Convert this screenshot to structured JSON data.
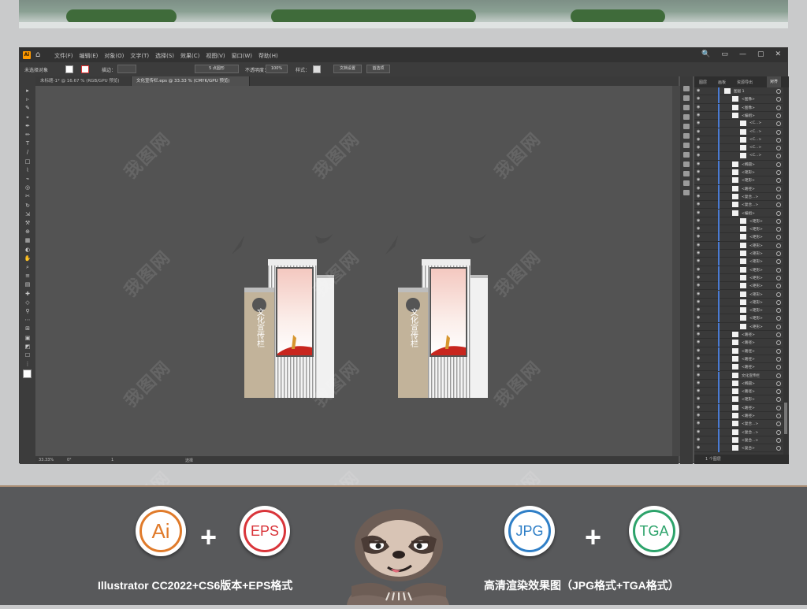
{
  "app": {
    "logo_text": "Ai",
    "menu": [
      "文件(F)",
      "编辑(E)",
      "对象(O)",
      "文字(T)",
      "选择(S)",
      "效果(C)",
      "视图(V)",
      "窗口(W)",
      "帮助(H)"
    ],
    "window_controls": [
      "🔍",
      "▭",
      "—",
      "▢",
      "✕"
    ]
  },
  "control_bar": {
    "selection_label": "未选择对象",
    "stroke_label": "描边：",
    "point_label": "5 点圆形",
    "opacity_label": "不透明度：",
    "opacity_value": "100%",
    "style_label": "样式：",
    "doc_setup_btn": "文档设置",
    "prefs_btn": "首选项"
  },
  "tabs": [
    {
      "label": "未标题-1* @ 16.67 % (RGB/GPU 预览)",
      "active": false
    },
    {
      "label": "文化宣传栏.eps @ 33.33 % (CMYK/GPU 预览)",
      "active": true
    }
  ],
  "status": {
    "zoom": "33.33%",
    "angle": "0°",
    "artboard": "1",
    "tool": "选择"
  },
  "layers_panel": {
    "tabs": [
      "图层",
      "画板",
      "资源导出",
      "对齐"
    ],
    "active_tab": "对齐",
    "rows": [
      {
        "name": "图层 1",
        "indent": 0,
        "expand": true
      },
      {
        "name": "<图像>",
        "indent": 1
      },
      {
        "name": "<图像>",
        "indent": 1
      },
      {
        "name": "<编组>",
        "indent": 1,
        "expand": true
      },
      {
        "name": "<C...>",
        "indent": 2
      },
      {
        "name": "<C...>",
        "indent": 2
      },
      {
        "name": "<C...>",
        "indent": 2
      },
      {
        "name": "<C...>",
        "indent": 2
      },
      {
        "name": "<C...>",
        "indent": 2
      },
      {
        "name": "<椭圆>",
        "indent": 1
      },
      {
        "name": "<矩形>",
        "indent": 1
      },
      {
        "name": "<矩形>",
        "indent": 1
      },
      {
        "name": "<路径>",
        "indent": 1
      },
      {
        "name": "<复合...>",
        "indent": 1
      },
      {
        "name": "<复合...>",
        "indent": 1
      },
      {
        "name": "<编组>",
        "indent": 1,
        "expand": true
      },
      {
        "name": "<矩形>",
        "indent": 2
      },
      {
        "name": "<矩形>",
        "indent": 2
      },
      {
        "name": "<矩形>",
        "indent": 2
      },
      {
        "name": "<矩形>",
        "indent": 2
      },
      {
        "name": "<矩形>",
        "indent": 2
      },
      {
        "name": "<矩形>",
        "indent": 2
      },
      {
        "name": "<矩形>",
        "indent": 2
      },
      {
        "name": "<矩形>",
        "indent": 2
      },
      {
        "name": "<矩形>",
        "indent": 2
      },
      {
        "name": "<矩形>",
        "indent": 2
      },
      {
        "name": "<矩形>",
        "indent": 2
      },
      {
        "name": "<矩形>",
        "indent": 2
      },
      {
        "name": "<矩形>",
        "indent": 2
      },
      {
        "name": "<矩形>",
        "indent": 2
      },
      {
        "name": "<路径>",
        "indent": 1
      },
      {
        "name": "<路径>",
        "indent": 1
      },
      {
        "name": "<路径>",
        "indent": 1
      },
      {
        "name": "<路径>",
        "indent": 1
      },
      {
        "name": "<路径>",
        "indent": 1
      },
      {
        "name": "文化宣传栏",
        "indent": 1
      },
      {
        "name": "<椭圆>",
        "indent": 1
      },
      {
        "name": "<路径>",
        "indent": 1
      },
      {
        "name": "<矩形>",
        "indent": 1
      },
      {
        "name": "<路径>",
        "indent": 1
      },
      {
        "name": "<路径>",
        "indent": 1
      },
      {
        "name": "<复合...>",
        "indent": 1
      },
      {
        "name": "<复合...>",
        "indent": 1
      },
      {
        "name": "<复合...>",
        "indent": 1
      },
      {
        "name": "<复合>",
        "indent": 1
      }
    ],
    "footer": "1 个图层"
  },
  "artwork": {
    "board_text": "文化宣传栏"
  },
  "watermark": "我图网",
  "banner": {
    "badge_ai": "Ai",
    "badge_eps": "EPS",
    "badge_jpg": "JPG",
    "badge_tga": "TGA",
    "plus": "+",
    "caption_left": "Illustrator CC2022+CS6版本+EPS格式",
    "caption_right": "高清渲染效果图（JPG格式+TGA格式）"
  },
  "colors": {
    "ai_orange": "#e07b2b",
    "eps_red": "#d9353a",
    "jpg_blue": "#2f7fc7",
    "tga_green": "#2da36b"
  }
}
